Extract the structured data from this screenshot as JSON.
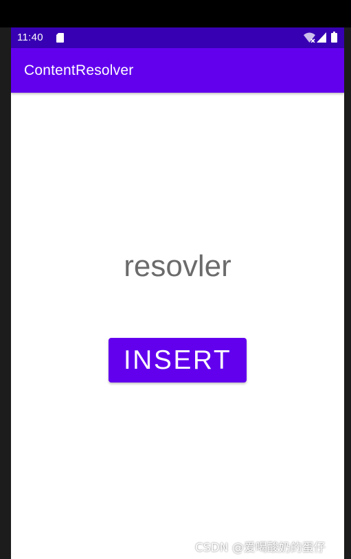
{
  "status_bar": {
    "time": "11:40",
    "icons": [
      "sd-card-icon",
      "wifi-icon",
      "signal-icon",
      "battery-icon"
    ]
  },
  "app_bar": {
    "title": "ContentResolver"
  },
  "main": {
    "label": "resovler",
    "insert_button_label": "INSERT"
  },
  "watermark": "CSDN @爱喝酸奶的蛋仔",
  "colors": {
    "status_bar": "#3700b3",
    "primary": "#6200ee",
    "text_secondary": "#6b6b6b",
    "background": "#ffffff"
  }
}
